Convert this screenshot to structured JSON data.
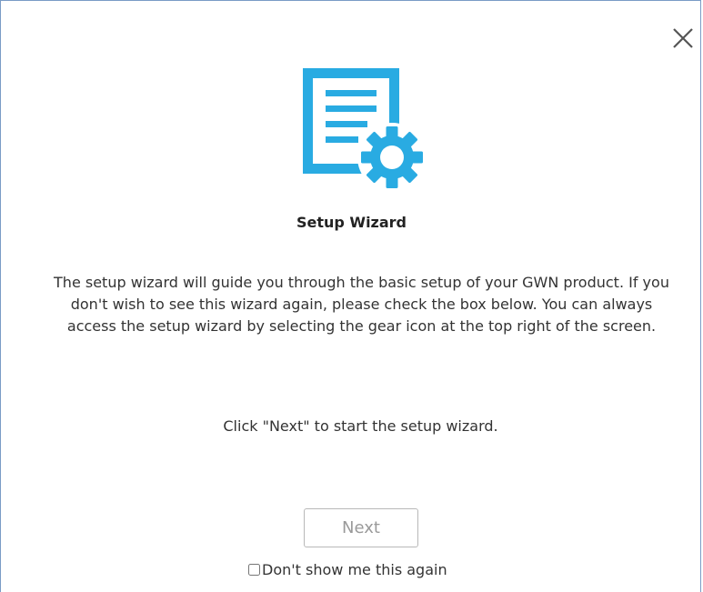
{
  "dialog": {
    "close_icon": "close-icon",
    "wizard_icon": "document-gear-icon",
    "accent_color": "#29abe2",
    "title": "Setup Wizard",
    "description": "The setup wizard will guide you through the basic setup of your GWN product. If you don't wish to see this wizard again, please check the box below. You can always access the setup wizard by selecting the gear icon at the top right of the screen.",
    "hint": "Click \"Next\" to start the setup wizard.",
    "next_label": "Next",
    "dont_show_label": "Don't show me this again",
    "dont_show_checked": false
  }
}
